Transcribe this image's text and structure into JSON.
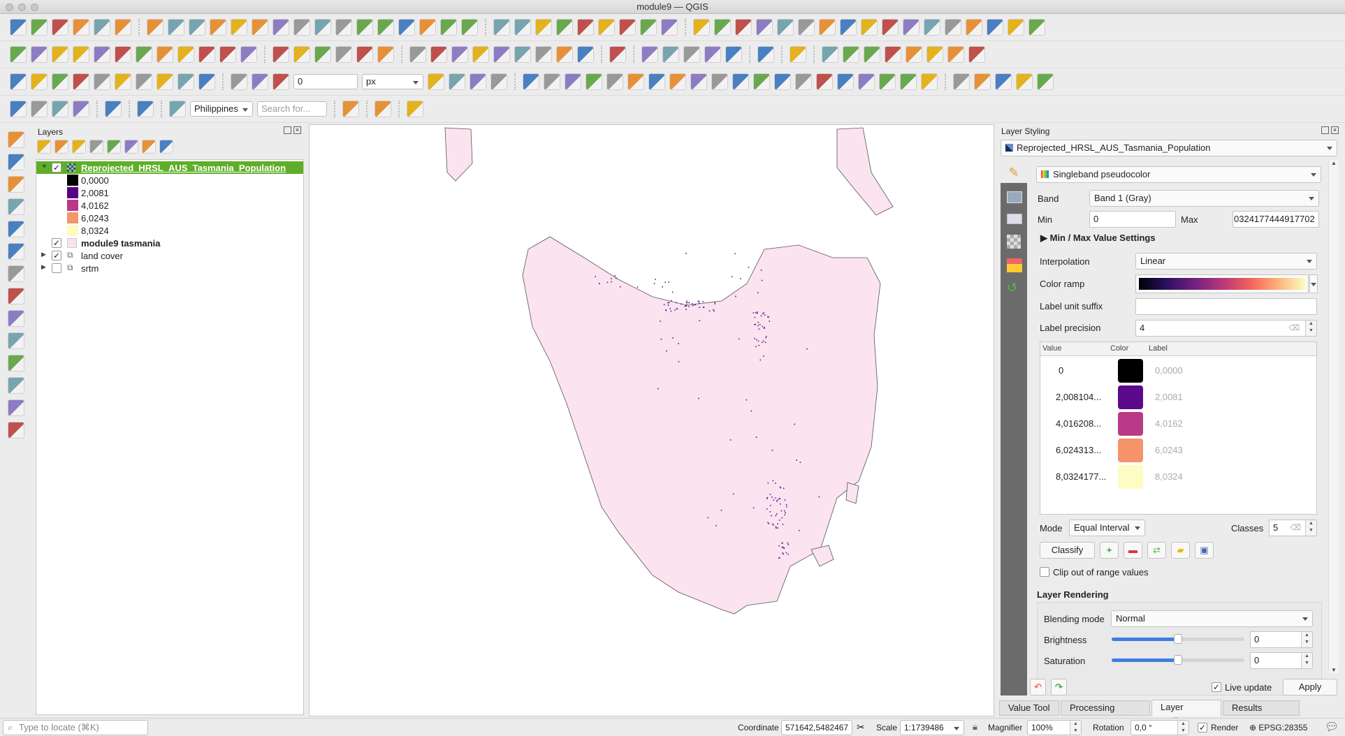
{
  "window": {
    "title": "module9 — QGIS"
  },
  "toolbars": {
    "row1": [
      "new-project-icon",
      "open-project-icon",
      "save-project-icon",
      "save-as-icon",
      "print-layout-icon",
      "style-manager-icon",
      "|",
      "pan-icon",
      "pan-to-selection-icon",
      "zoom-in-icon",
      "zoom-out-icon",
      "zoom-full-icon",
      "zoom-selection-icon",
      "zoom-layer-icon",
      "zoom-native-icon",
      "zoom-last-icon",
      "zoom-next-icon",
      "new-map-view-icon",
      "new-3d-view-icon",
      "bookmark-icon",
      "show-bookmarks-icon",
      "temporal-icon",
      "refresh-icon",
      "|",
      "identify-icon",
      "attribute-table-icon",
      "field-calc-icon",
      "processing-icon",
      "statistics-icon",
      "measure-icon",
      "map-tips-icon",
      "select-feature-icon",
      "text-annotation-icon",
      "|",
      "digitize-1-icon",
      "digitize-2-icon",
      "digitize-3-icon",
      "digitize-4-icon",
      "digitize-5-icon",
      "digitize-6-icon",
      "digitize-7-icon",
      "digitize-8-icon",
      "digitize-9-icon",
      "digitize-10-icon",
      "digitize-11-icon",
      "digitize-12-icon",
      "digitize-13-icon",
      "digitize-14-icon",
      "digitize-15-icon",
      "digitize-16-icon",
      "digitize-17-icon"
    ],
    "row2": [
      "edits-icon",
      "toggle-editing-icon",
      "save-edits-icon",
      "add-point-icon",
      "vertex-tool-icon",
      "modify-attributes-icon",
      "delete-selected-icon",
      "cut-icon",
      "copy-icon",
      "paste-icon",
      "undo-icon",
      "redo-icon",
      "|",
      "add-layer-icon",
      "layer-from-wms-icon",
      "vector-icon",
      "digitize-polyline-icon",
      "table-icon",
      "vector-v-icon",
      "|",
      "label-icon",
      "label-pin-icon",
      "label-abc-icon",
      "label-abc-red-icon",
      "label-1-icon",
      "label-2-icon",
      "label-3-icon",
      "label-4-icon",
      "label-5-icon",
      "|",
      "database-icon",
      "|",
      "polygon-icon",
      "globe-1-icon",
      "globe-2-icon",
      "plugin-green-icon",
      "globe-3-icon",
      "|",
      "point-icon",
      "|",
      "help-icon",
      "|",
      "circle-icon",
      "xy-icon",
      "line-tool-icon",
      "star-tool-icon",
      "snap-icon",
      "ruler-icon",
      "number-123-icon",
      "route-icon"
    ],
    "row3": [
      "histogram-1-icon",
      "histogram-2-icon",
      "histogram-3-icon",
      "histogram-4-icon",
      "brightness-up-icon",
      "brightness-down-icon",
      "contrast-up-icon",
      "contrast-down-icon",
      "gamma-up-icon",
      "gamma-down-icon",
      "|",
      "magnet-icon",
      "snap-vertex-icon",
      "snap-grid-icon",
      "@field",
      "@unit",
      "trim-icon",
      "reshape-icon",
      "split-icon",
      "extend-icon",
      "|",
      "python-icon",
      "grid-plugin-icon",
      "plugin-3-icon",
      "folder-plugin-icon",
      "plugin-5-icon",
      "number-4-icon",
      "plugin-7-icon",
      "sphere-icon",
      "binoculars-icon",
      "ref-icon",
      "grid-icon",
      "plugin-layers-icon",
      "table-grid-icon",
      "network-icon",
      "pca-icon",
      "recycle-icon",
      "info-green-icon",
      "pointer-icon",
      "openeo-icon",
      "book-icon",
      "|",
      "style-1-icon",
      "style-2-icon",
      "style-3-icon",
      "style-4-icon",
      "style-5-icon"
    ],
    "row4": [
      "select-rect-icon",
      "deselect-icon",
      "select-polygon-icon",
      "select-point-icon",
      "|",
      "shield-icon",
      "|",
      "route-yellow-icon",
      "|",
      "locator-icon",
      "@country",
      "@search",
      "|",
      "chart-icon",
      "|",
      "edc-icon",
      "|",
      "sld-icon"
    ],
    "snap_value": "0",
    "snap_unit": "px",
    "country": "Philippines",
    "search_placeholder": "Search for..."
  },
  "left_tools": [
    "add-vector-icon",
    "add-raster-icon",
    "add-mesh-icon",
    "add-delimited-icon",
    "add-gpx-icon",
    "add-spatialite-icon",
    "add-postgis-icon",
    "add-wms-icon",
    "add-wfs-icon",
    "add-wcs-icon",
    "add-virtual-icon",
    "georeferencer-icon",
    "gps-icon",
    "crosshair-icon"
  ],
  "layers": {
    "title": "Layers",
    "toolbar": [
      "open-styling-icon",
      "add-group-icon",
      "visibility-icon",
      "filter-icon",
      "expression-filter-icon",
      "expand-all-icon",
      "collapse-all-icon",
      "remove-layer-icon"
    ],
    "items": [
      {
        "name": "Reprojected_HRSL_AUS_Tasmania_Population",
        "checked": true,
        "selected": true,
        "expanded": true,
        "legend": [
          {
            "label": "0,0000",
            "color": "#000000"
          },
          {
            "label": "2,0081",
            "color": "#560087"
          },
          {
            "label": "4,0162",
            "color": "#b83a86"
          },
          {
            "label": "6,0243",
            "color": "#f4956a"
          },
          {
            "label": "8,0324",
            "color": "#fcfcc3"
          }
        ]
      },
      {
        "name": "module9 tasmania",
        "checked": true,
        "color": "#fbe3f0"
      },
      {
        "name": "land cover",
        "checked": true,
        "group": true
      },
      {
        "name": "srtm",
        "checked": false,
        "group": true
      }
    ]
  },
  "styling": {
    "title": "Layer Styling",
    "layer": "Reprojected_HRSL_AUS_Tasmania_Population",
    "renderer": "Singleband pseudocolor",
    "band_label": "Band",
    "band": "Band 1 (Gray)",
    "min_label": "Min",
    "min": "0",
    "max_label": "Max",
    "max": "0324177444917702",
    "minmax_settings": "Min / Max Value Settings",
    "interpolation_label": "Interpolation",
    "interpolation": "Linear",
    "color_ramp_label": "Color ramp",
    "suffix_label": "Label unit suffix",
    "suffix": "",
    "precision_label": "Label precision",
    "precision": "4",
    "table_headers": [
      "Value",
      "Color",
      "Label"
    ],
    "classes_table": [
      {
        "value": "0",
        "color": "#000000",
        "label": "0,0000"
      },
      {
        "value": "2,008104...",
        "color": "#5c0a8c",
        "label": "2,0081"
      },
      {
        "value": "4,016208...",
        "color": "#b93a86",
        "label": "4,0162"
      },
      {
        "value": "6,024313...",
        "color": "#f49468",
        "label": "6,0243"
      },
      {
        "value": "8,0324177...",
        "color": "#fcfcc4",
        "label": "8,0324"
      }
    ],
    "mode_label": "Mode",
    "mode": "Equal Interval",
    "classes_label": "Classes",
    "classes": "5",
    "classify": "Classify",
    "clip_label": "Clip out of range values",
    "clip": false,
    "rendering_title": "Layer Rendering",
    "blending_label": "Blending mode",
    "blending": "Normal",
    "brightness_label": "Brightness",
    "brightness": "0",
    "saturation_label": "Saturation",
    "saturation": "0",
    "brightness_slider_pct": 50,
    "saturation_slider_pct": 50,
    "live_update_label": "Live update",
    "live_update": true,
    "apply": "Apply"
  },
  "dock_tabs": [
    {
      "label": "Value Tool"
    },
    {
      "label": "Processing Toolbox"
    },
    {
      "label": "Layer Styling",
      "active": true
    },
    {
      "label": "Results Viewer"
    }
  ],
  "status": {
    "locate_placeholder": "Type to locate (⌘K)",
    "coordinate_label": "Coordinate",
    "coordinate": "571642,5482467",
    "scale_label": "Scale",
    "scale": "1:1739486",
    "magnifier_label": "Magnifier",
    "magnifier": "100%",
    "rotation_label": "Rotation",
    "rotation": "0,0 °",
    "render_label": "Render",
    "render": true,
    "crs": "EPSG:28355"
  },
  "colors": {
    "selected_layer": "#5fae29",
    "island_fill": "#fbe3f0",
    "population": "#5a1a8c"
  }
}
